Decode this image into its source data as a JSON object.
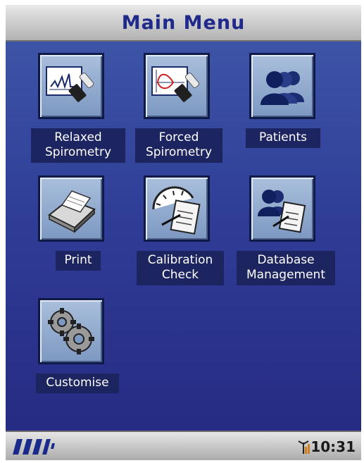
{
  "header": {
    "title": "Main Menu"
  },
  "menu": {
    "items": [
      {
        "label": "Relaxed\nSpirometry",
        "icon": "relaxed-spirometry-icon"
      },
      {
        "label": "Forced\nSpirometry",
        "icon": "forced-spirometry-icon"
      },
      {
        "label": "Patients",
        "icon": "patients-icon"
      },
      {
        "label": "Print",
        "icon": "printer-icon"
      },
      {
        "label": "Calibration\nCheck",
        "icon": "calibration-check-icon"
      },
      {
        "label": "Database\nManagement",
        "icon": "database-management-icon"
      },
      {
        "label": "Customise",
        "icon": "gears-icon"
      }
    ]
  },
  "status": {
    "time": "10:31",
    "battery_icon": "battery-icon",
    "signal_icon": "antenna-signal-icon"
  },
  "colors": {
    "title_text": "#1f2a8a",
    "background_top": "#3d54a6",
    "background_bottom": "#262b83",
    "label_bg": "#1d2560",
    "tile_bg": "#a9bfdc"
  }
}
